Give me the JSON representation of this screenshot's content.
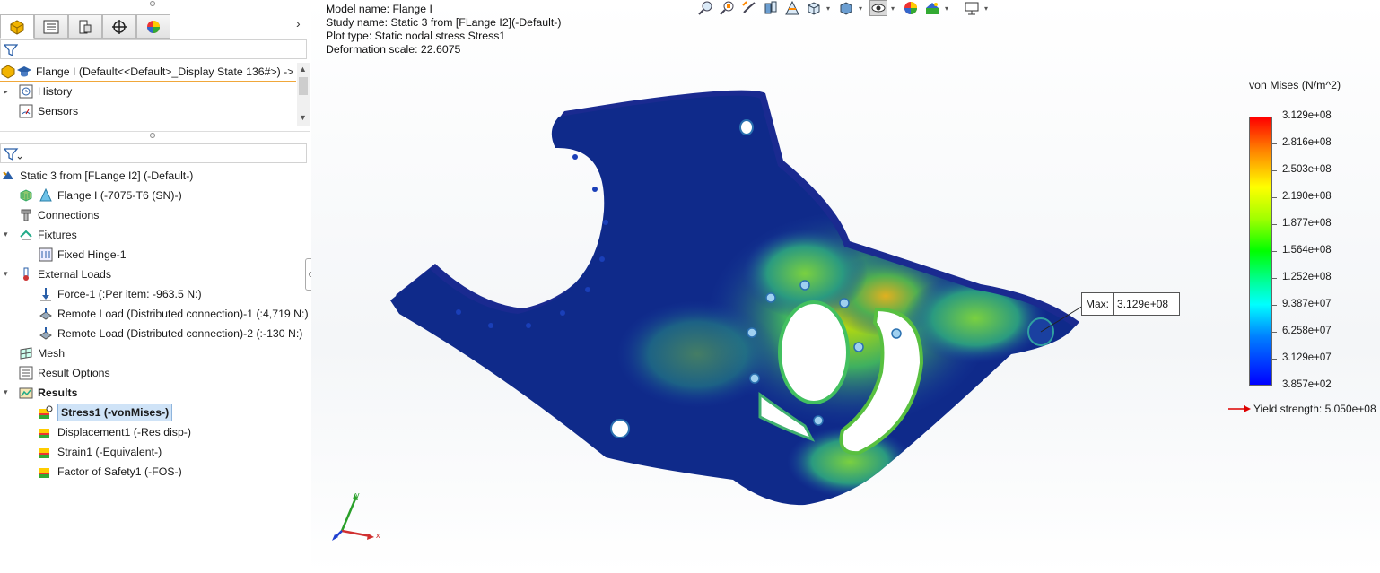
{
  "feature_manager": {
    "tabs": [
      {
        "name": "featuremanager-tab",
        "icon": "featuremanager-icon"
      },
      {
        "name": "propertymanager-tab",
        "icon": "propertymanager-icon"
      },
      {
        "name": "configurationmanager-tab",
        "icon": "configuration-icon"
      },
      {
        "name": "dimxpert-tab",
        "icon": "target-icon"
      },
      {
        "name": "display-manager-tab",
        "icon": "appearance-icon"
      }
    ],
    "part_row": "Flange I  (Default<<Default>_Display State 136#>) ->",
    "history": "History",
    "sensors": "Sensors"
  },
  "study_tree": {
    "study": "Static 3 from [FLange I2] (-Default-)",
    "part": "Flange I (-7075-T6 (SN)-)",
    "connections": "Connections",
    "fixtures": "Fixtures",
    "fixture_1": "Fixed Hinge-1",
    "external_loads": "External Loads",
    "force_1": "Force-1 (:Per item: -963.5 N:)",
    "remote_load_1": "Remote Load (Distributed connection)-1 (:4,719 N:)",
    "remote_load_2": "Remote Load (Distributed connection)-2 (:-130 N:)",
    "mesh": "Mesh",
    "result_options": "Result Options",
    "results": "Results",
    "stress": "Stress1 (-vonMises-)",
    "displacement": "Displacement1 (-Res disp-)",
    "strain": "Strain1 (-Equivalent-)",
    "fos": "Factor of Safety1 (-FOS-)"
  },
  "model_info": {
    "model_name": "Model name: Flange I",
    "study_name": "Study name: Static 3 from [FLange I2](-Default-)",
    "plot_type": "Plot type: Static nodal stress Stress1",
    "deformation": "Deformation scale: 22.6075"
  },
  "legend": {
    "title": "von Mises (N/m^2)",
    "ticks": [
      "3.129e+08",
      "2.816e+08",
      "2.503e+08",
      "2.190e+08",
      "1.877e+08",
      "1.564e+08",
      "1.252e+08",
      "9.387e+07",
      "6.258e+07",
      "3.129e+07",
      "3.857e+02"
    ],
    "yield": "Yield strength: 5.050e+08",
    "colors": {
      "max": "#ff0000",
      "mid": "#00ff00",
      "min": "#0000ff"
    }
  },
  "probe": {
    "label": "Max:",
    "value": "3.129e+08"
  },
  "triad": {
    "x": "x",
    "y": "y"
  }
}
